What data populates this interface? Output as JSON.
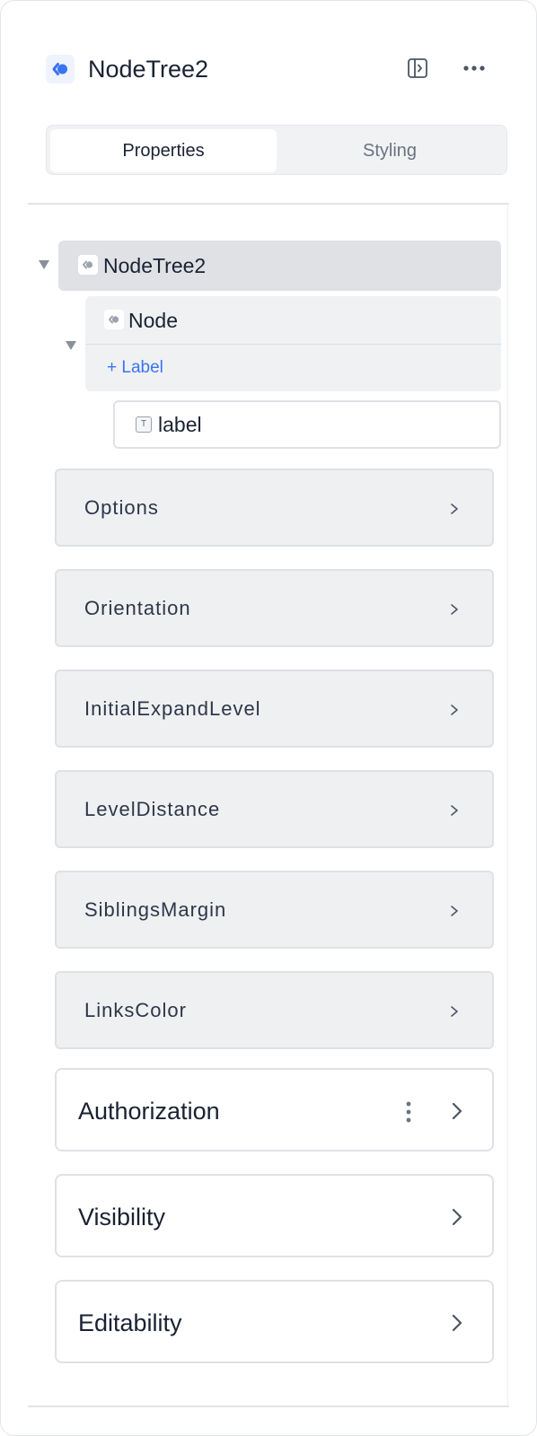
{
  "header": {
    "title": "NodeTree2",
    "icons": {
      "component": "component-icon",
      "panel_toggle": "panel-toggle-icon",
      "more": "more-icon"
    }
  },
  "tabs": [
    {
      "label": "Properties",
      "active": true
    },
    {
      "label": "Styling",
      "active": false
    }
  ],
  "tree": {
    "root": {
      "label": "NodeTree2",
      "icon": "component-icon"
    },
    "child": {
      "label": "Node",
      "icon": "component-icon",
      "add_label": "+ Label"
    },
    "leaf": {
      "label": "label",
      "icon": "text-icon",
      "icon_glyph": "T"
    }
  },
  "properties": [
    {
      "label": "Options"
    },
    {
      "label": "Orientation"
    },
    {
      "label": "InitialExpandLevel"
    },
    {
      "label": "LevelDistance"
    },
    {
      "label": "SiblingsMargin"
    },
    {
      "label": "LinksColor"
    }
  ],
  "sections": [
    {
      "label": "Authorization",
      "has_menu": true
    },
    {
      "label": "Visibility",
      "has_menu": false
    },
    {
      "label": "Editability",
      "has_menu": false
    }
  ],
  "colors": {
    "accent": "#3b74f0",
    "root_bg": "#dfe1e5",
    "row_bg": "#eff0f2",
    "text": "#1a2233"
  }
}
